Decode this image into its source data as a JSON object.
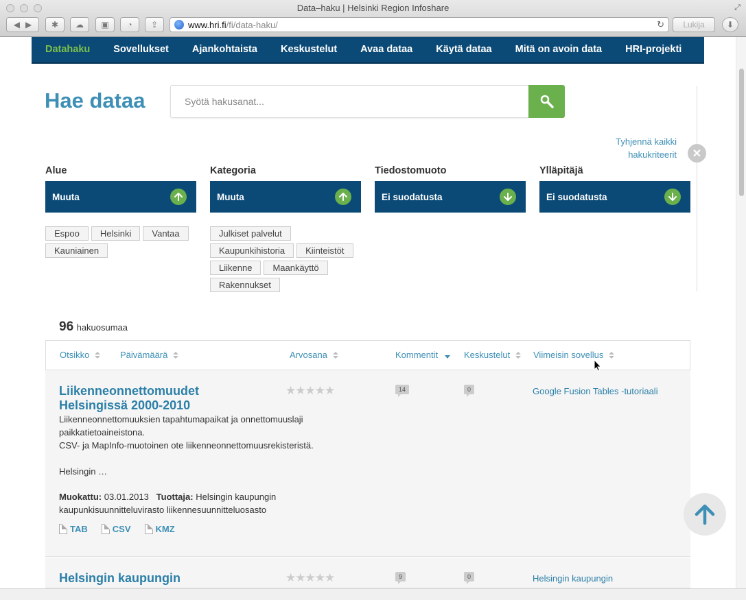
{
  "browser": {
    "window_title": "Data–haku | Helsinki Region Infoshare",
    "url_host": "www.hri.fi",
    "url_path": "/fi/data-haku/",
    "reader_label": "Lukija"
  },
  "nav": {
    "items": [
      "Datahaku",
      "Sovellukset",
      "Ajankohtaista",
      "Keskustelut",
      "Avaa dataa",
      "Käytä dataa",
      "Mitä on avoin data",
      "HRI-projekti"
    ],
    "active": "Datahaku"
  },
  "search": {
    "title": "Hae dataa",
    "placeholder": "Syötä hakusanat..."
  },
  "clear_all": "Tyhjennä kaikki hakukriteerit",
  "filters": [
    {
      "label": "Alue",
      "button": "Muuta",
      "icon": "arrow-up-icon",
      "tags": [
        "Espoo",
        "Helsinki",
        "Vantaa",
        "Kauniainen"
      ]
    },
    {
      "label": "Kategoria",
      "button": "Muuta",
      "icon": "arrow-up-icon",
      "tags": [
        "Julkiset palvelut",
        "Kaupunkihistoria",
        "Kiinteistöt",
        "Liikenne",
        "Maankäyttö",
        "Rakennukset"
      ]
    },
    {
      "label": "Tiedostomuoto",
      "button": "Ei suodatusta",
      "icon": "arrow-down-icon",
      "tags": []
    },
    {
      "label": "Ylläpitäjä",
      "button": "Ei suodatusta",
      "icon": "arrow-down-icon",
      "tags": []
    }
  ],
  "results": {
    "count": "96",
    "count_label": "hakuosumaa",
    "columns": [
      "Otsikko",
      "Päivämäärä",
      "Arvosana",
      "Kommentit",
      "Keskustelut",
      "Viimeisin sovellus"
    ],
    "rows": [
      {
        "title": "Liikenneonnettomuudet Helsingissä 2000-2010",
        "desc_lines": [
          "Liikenneonnettomuuksien tapahtumapaikat ja onnettomuuslaji paikkatietoaineistona.",
          "CSV- ja MapInfo-muotoinen ote liikenneonnettomuusrekisteristä.",
          "",
          "Helsingin …"
        ],
        "modified_label": "Muokattu:",
        "modified": "03.01.2013",
        "producer_label": "Tuottaja:",
        "producer": "Helsingin kaupungin kaupunkisuunnitteluvirasto liikennesuunnitteluosasto",
        "files": [
          "TAB",
          "CSV",
          "KMZ"
        ],
        "rating": 0,
        "comments": "14",
        "discussions": "0",
        "latest_app": "Google Fusion Tables -tutoriaali"
      },
      {
        "title": "Helsingin kaupungin",
        "comments": "9",
        "discussions": "0",
        "latest_app": "Helsingin kaupungin",
        "rating": 0
      }
    ]
  },
  "colors": {
    "nav_bg": "#0b4a76",
    "accent_green": "#6ab04c",
    "link_blue": "#3d8fb5"
  }
}
